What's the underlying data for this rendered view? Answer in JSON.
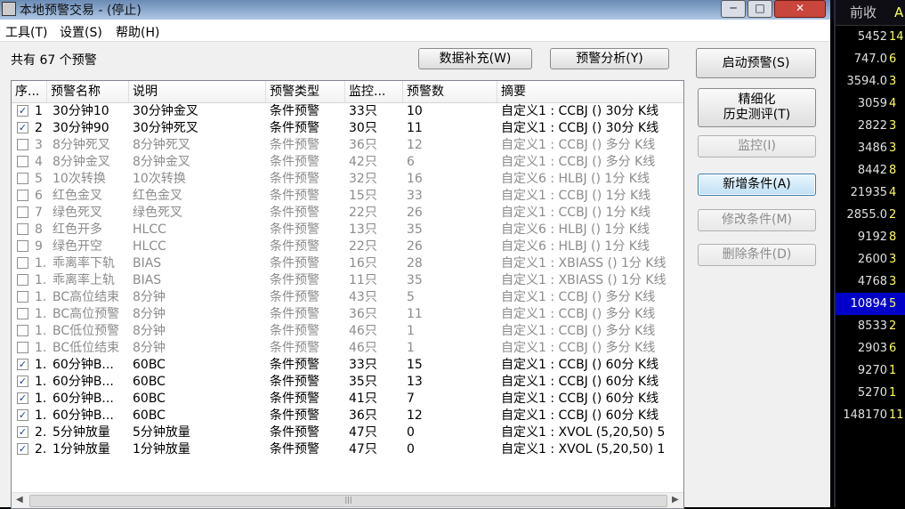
{
  "window": {
    "title": "本地预警交易 - (停止)",
    "controls": [
      "─",
      "□",
      "✕"
    ]
  },
  "menu": [
    "工具(T)",
    "设置(S)",
    "帮助(H)"
  ],
  "count_text": "共有 67 个预警",
  "top_buttons": {
    "data_fill": "数据补充(W)",
    "analysis": "预警分析(Y)"
  },
  "side_buttons": [
    {
      "label": "启动预警(S)",
      "state": "enabled"
    },
    {
      "label": "精细化\n历史测评(T)",
      "state": "enabled"
    },
    {
      "label": "监控(I)",
      "state": "disabled"
    },
    {
      "label": "新增条件(A)",
      "state": "focused"
    },
    {
      "label": "修改条件(M)",
      "state": "disabled"
    },
    {
      "label": "删除条件(D)",
      "state": "disabled"
    }
  ],
  "columns": [
    "序...",
    "预警名称",
    "说明",
    "预警类型",
    "监控...",
    "预警数",
    "摘要"
  ],
  "rows": [
    {
      "checked": true,
      "seq": "1",
      "name": "30分钟10",
      "desc": "30分钟金叉",
      "type": "条件预警",
      "monitor": "33只",
      "count": "10",
      "summary": "自定义1 : CCBJ () 30分 K线"
    },
    {
      "checked": true,
      "seq": "2",
      "name": "30分钟90",
      "desc": "30分钟死叉",
      "type": "条件预警",
      "monitor": "30只",
      "count": "11",
      "summary": "自定义1 : CCBJ () 30分 K线"
    },
    {
      "checked": false,
      "seq": "3",
      "name": "8分钟死叉",
      "desc": "8分钟死叉",
      "type": "条件预警",
      "monitor": "36只",
      "count": "12",
      "summary": "自定义1 : CCBJ () 多分 K线"
    },
    {
      "checked": false,
      "seq": "4",
      "name": "8分钟金叉",
      "desc": "8分钟金叉",
      "type": "条件预警",
      "monitor": "42只",
      "count": "6",
      "summary": "自定义1 : CCBJ () 多分 K线"
    },
    {
      "checked": false,
      "seq": "5",
      "name": "10次转换",
      "desc": "10次转换",
      "type": "条件预警",
      "monitor": "32只",
      "count": "16",
      "summary": "自定义6 : HLBJ () 1分 K线"
    },
    {
      "checked": false,
      "seq": "6",
      "name": "红色金叉",
      "desc": "红色金叉",
      "type": "条件预警",
      "monitor": "15只",
      "count": "33",
      "summary": "自定义1 : CCBJ () 1分 K线"
    },
    {
      "checked": false,
      "seq": "7",
      "name": "绿色死叉",
      "desc": "绿色死叉",
      "type": "条件预警",
      "monitor": "22只",
      "count": "26",
      "summary": "自定义1 : CCBJ () 1分 K线"
    },
    {
      "checked": false,
      "seq": "8",
      "name": "红色开多",
      "desc": "HLCC",
      "type": "条件预警",
      "monitor": "13只",
      "count": "35",
      "summary": "自定义6 : HLBJ () 1分 K线"
    },
    {
      "checked": false,
      "seq": "9",
      "name": "绿色开空",
      "desc": "HLCC",
      "type": "条件预警",
      "monitor": "22只",
      "count": "26",
      "summary": "自定义6 : HLBJ () 1分 K线"
    },
    {
      "checked": false,
      "seq": "1.",
      "name": "乖离率下轨",
      "desc": "BIAS",
      "type": "条件预警",
      "monitor": "16只",
      "count": "28",
      "summary": "自定义1 : XBIASS () 1分 K线"
    },
    {
      "checked": false,
      "seq": "1.",
      "name": "乖离率上轨",
      "desc": "BIAS",
      "type": "条件预警",
      "monitor": "11只",
      "count": "35",
      "summary": "自定义1 : XBIASS () 1分 K线"
    },
    {
      "checked": false,
      "seq": "1.",
      "name": "BC高位结束",
      "desc": "8分钟",
      "type": "条件预警",
      "monitor": "43只",
      "count": "5",
      "summary": "自定义1 : CCBJ () 多分 K线"
    },
    {
      "checked": false,
      "seq": "1.",
      "name": "BC高位预警",
      "desc": "8分钟",
      "type": "条件预警",
      "monitor": "36只",
      "count": "11",
      "summary": "自定义1 : CCBJ () 多分 K线"
    },
    {
      "checked": false,
      "seq": "1.",
      "name": "BC低位预警",
      "desc": "8分钟",
      "type": "条件预警",
      "monitor": "46只",
      "count": "1",
      "summary": "自定义1 : CCBJ () 多分 K线"
    },
    {
      "checked": false,
      "seq": "1.",
      "name": "BC低位结束",
      "desc": "8分钟",
      "type": "条件预警",
      "monitor": "46只",
      "count": "1",
      "summary": "自定义1 : CCBJ () 多分 K线"
    },
    {
      "checked": true,
      "seq": "1.",
      "name": "60分钟B...",
      "desc": "60BC",
      "type": "条件预警",
      "monitor": "33只",
      "count": "15",
      "summary": "自定义1 : CCBJ () 60分 K线"
    },
    {
      "checked": true,
      "seq": "1.",
      "name": "60分钟B...",
      "desc": "60BC",
      "type": "条件预警",
      "monitor": "35只",
      "count": "13",
      "summary": "自定义1 : CCBJ () 60分 K线"
    },
    {
      "checked": true,
      "seq": "1.",
      "name": "60分钟B...",
      "desc": "60BC",
      "type": "条件预警",
      "monitor": "41只",
      "count": "7",
      "summary": "自定义1 : CCBJ () 60分 K线"
    },
    {
      "checked": true,
      "seq": "1.",
      "name": "60分钟B...",
      "desc": "60BC",
      "type": "条件预警",
      "monitor": "36只",
      "count": "12",
      "summary": "自定义1 : CCBJ () 60分 K线"
    },
    {
      "checked": true,
      "seq": "2.",
      "name": "5分钟放量",
      "desc": "5分钟放量",
      "type": "条件预警",
      "monitor": "47只",
      "count": "0",
      "summary": "自定义1 : XVOL (5,20,50) 5"
    },
    {
      "checked": true,
      "seq": "2.",
      "name": "1分钟放量",
      "desc": "1分钟放量",
      "type": "条件预警",
      "monitor": "47只",
      "count": "0",
      "summary": "自定义1 : XVOL (5,20,50) 1"
    }
  ],
  "right_panel": {
    "header": "前收",
    "header_extra": "A",
    "highlight_index": 7,
    "values": [
      {
        "v": "5452",
        "x": "14"
      },
      {
        "v": "747.0",
        "x": "6"
      },
      {
        "v": "3594.0",
        "x": "3"
      },
      {
        "v": "3059",
        "x": "4"
      },
      {
        "v": "2822",
        "x": "3"
      },
      {
        "v": "3486",
        "x": "3"
      },
      {
        "v": "8442",
        "x": "8"
      },
      {
        "v": "21935",
        "x": "4"
      },
      {
        "v": "2855.0",
        "x": "2"
      },
      {
        "v": "9192",
        "x": "8"
      },
      {
        "v": "2600",
        "x": "3"
      },
      {
        "v": "4768",
        "x": "3"
      },
      {
        "v": "10894",
        "x": "5"
      },
      {
        "v": "8533",
        "x": "2"
      },
      {
        "v": "2903",
        "x": "6"
      },
      {
        "v": "9270",
        "x": "1"
      },
      {
        "v": "5270",
        "x": "1"
      },
      {
        "v": "148170",
        "x": "11"
      }
    ]
  }
}
